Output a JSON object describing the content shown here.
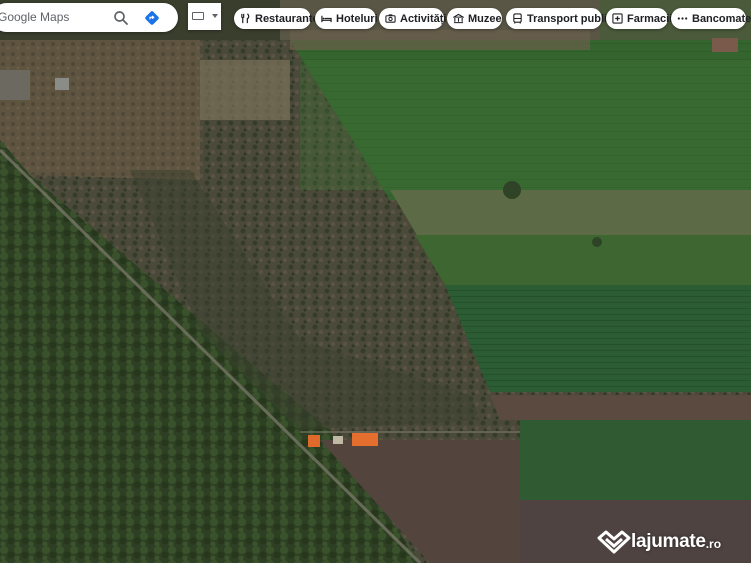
{
  "search": {
    "placeholder": "Google Maps"
  },
  "categories": [
    {
      "label": "Restaurante",
      "icon": "fork-knife-icon"
    },
    {
      "label": "Hoteluri",
      "icon": "bed-icon"
    },
    {
      "label": "Activități",
      "icon": "camera-icon"
    },
    {
      "label": "Muzee",
      "icon": "museum-icon"
    },
    {
      "label": "Transport public",
      "icon": "bus-icon"
    },
    {
      "label": "Farmacii",
      "icon": "pharmacy-icon"
    },
    {
      "label": "Bancomate",
      "icon": "atm-icon"
    }
  ],
  "map": {
    "view": "satellite"
  },
  "watermark": {
    "text": "lajumate",
    "suffix": ".ro"
  },
  "colors": {
    "forest": "#2c3d22",
    "field": "#3d6a30",
    "chip_bg": "#ffffff",
    "icon_grey": "#5f6368"
  }
}
